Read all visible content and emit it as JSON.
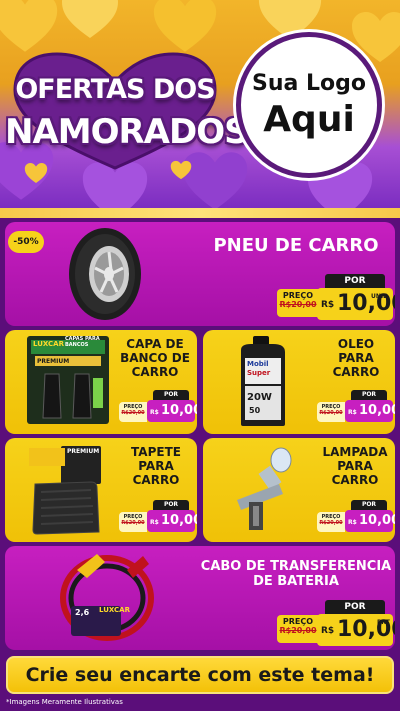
{
  "header": {
    "title_line1": "OFERTAS DOS",
    "title_line2": "NAMORADOS",
    "logo_line1": "Sua Logo",
    "logo_line2": "Aqui"
  },
  "discount_badge": "-50%",
  "products": [
    {
      "name": "PNEU DE CARRO",
      "por": "POR",
      "preco": "PREÇO",
      "old_price": "R$20,00",
      "currency": "R$",
      "price": "10,00",
      "unit": "UNID"
    },
    {
      "name": "CAPA DE BANCO DE CARRO",
      "por": "POR",
      "preco": "PREÇO",
      "old_price": "R$20,00",
      "currency": "R$",
      "price": "10,00",
      "unit": ""
    },
    {
      "name": "OLEO PARA CARRO",
      "por": "POR",
      "preco": "PREÇO",
      "old_price": "R$20,00",
      "currency": "R$",
      "price": "10,00",
      "unit": ""
    },
    {
      "name": "TAPETE PARA CARRO",
      "por": "POR",
      "preco": "PREÇO",
      "old_price": "R$20,00",
      "currency": "R$",
      "price": "10,00",
      "unit": ""
    },
    {
      "name": "LAMPADA PARA CARRO",
      "por": "POR",
      "preco": "PREÇO",
      "old_price": "R$20,00",
      "currency": "R$",
      "price": "10,00",
      "unit": ""
    },
    {
      "name": "CABO DE TRANSFERENCIA DE BATERIA",
      "por": "POR",
      "preco": "PREÇO",
      "old_price": "R$20,00",
      "currency": "R$",
      "price": "10,00",
      "unit": "PRT"
    }
  ],
  "product_labels": {
    "seat_brand": "LUXCAR",
    "seat_box_text": "CAPAS PARA BANCOS",
    "seat_badge": "PREMIUM",
    "oil_brand_1": "Mobil",
    "oil_brand_2": "Super",
    "oil_grade_1": "20W",
    "oil_grade_2": "50",
    "mat_badge": "PREMIUM",
    "cable_brand": "LUXCAR",
    "cable_size": "2,6"
  },
  "cta": "Crie seu encarte com este tema!",
  "footnote": "*Imagens Meramente Ilustrativas",
  "colors": {
    "purple_dark": "#5b0e7a",
    "magenta": "#c71fc0",
    "yellow": "#f6d21a",
    "gold": "#f2b52a"
  }
}
